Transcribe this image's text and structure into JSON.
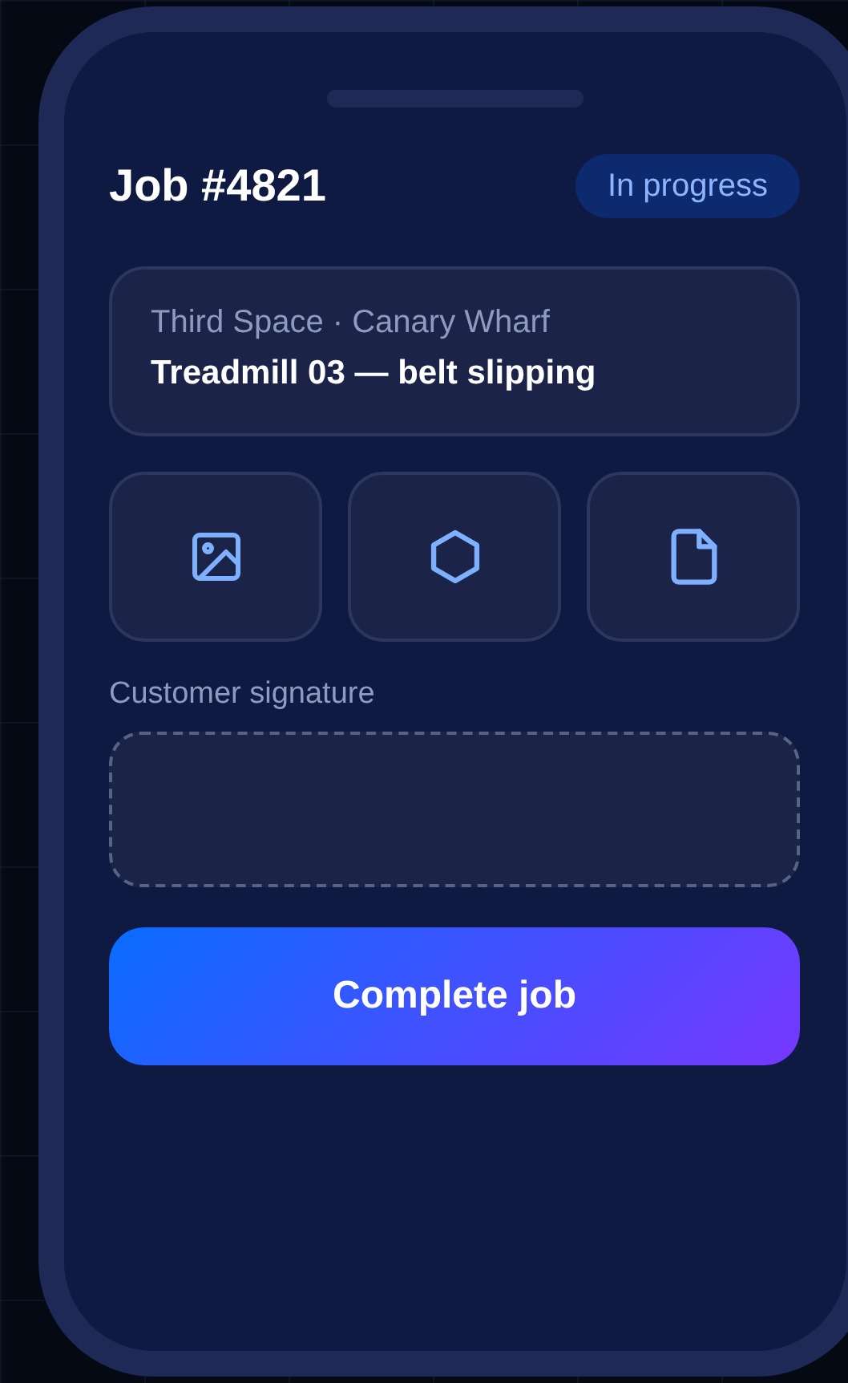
{
  "job": {
    "title": "Job #4821",
    "status": "In progress"
  },
  "info": {
    "location": "Third Space · Canary Wharf",
    "issue": "Treadmill 03 — belt slipping"
  },
  "attachments": [
    {
      "kind": "photo"
    },
    {
      "kind": "part"
    },
    {
      "kind": "document"
    }
  ],
  "signature": {
    "label": "Customer signature"
  },
  "primary_action": {
    "label": "Complete job"
  }
}
